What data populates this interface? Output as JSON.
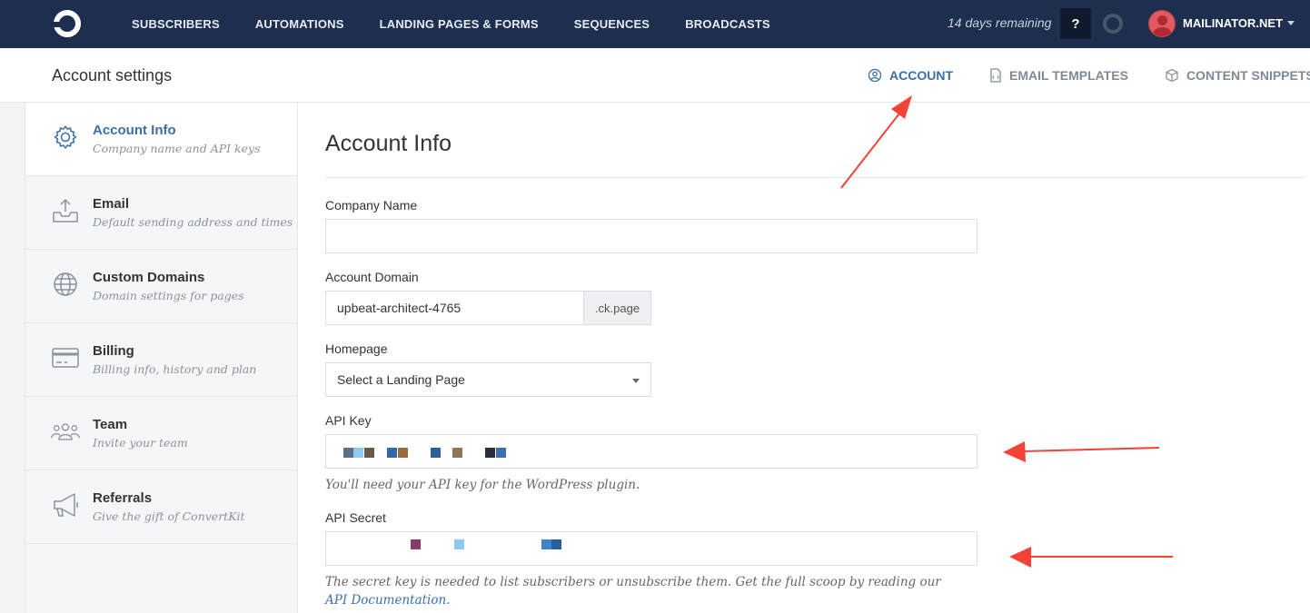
{
  "topnav": {
    "items": [
      "SUBSCRIBERS",
      "AUTOMATIONS",
      "LANDING PAGES & FORMS",
      "SEQUENCES",
      "BROADCASTS"
    ],
    "trial_text": "14 days remaining",
    "help_label": "?",
    "user_label": "MAILINATOR.NET"
  },
  "subheader": {
    "title": "Account settings",
    "tabs": [
      {
        "label": "ACCOUNT",
        "icon": "user-circle-icon",
        "active": true
      },
      {
        "label": "EMAIL TEMPLATES",
        "icon": "document-icon",
        "active": false
      },
      {
        "label": "CONTENT SNIPPETS",
        "icon": "cube-icon",
        "active": false
      }
    ]
  },
  "sidebar": {
    "items": [
      {
        "name": "Account Info",
        "desc": "Company name and API keys",
        "icon": "gear-icon",
        "active": true
      },
      {
        "name": "Email",
        "desc": "Default sending address and times",
        "icon": "inbox-upload-icon",
        "active": false
      },
      {
        "name": "Custom Domains",
        "desc": "Domain settings for pages",
        "icon": "globe-icon",
        "active": false
      },
      {
        "name": "Billing",
        "desc": "Billing info, history and plan",
        "icon": "credit-card-icon",
        "active": false
      },
      {
        "name": "Team",
        "desc": "Invite your team",
        "icon": "team-icon",
        "active": false
      },
      {
        "name": "Referrals",
        "desc": "Give the gift of ConvertKit",
        "icon": "megaphone-icon",
        "active": false
      }
    ]
  },
  "main": {
    "title": "Account Info",
    "company_label": "Company Name",
    "company_value": "",
    "domain_label": "Account Domain",
    "domain_value": "upbeat-architect-4765",
    "domain_suffix": ".ck.page",
    "homepage_label": "Homepage",
    "homepage_value": "Select a Landing Page",
    "api_key_label": "API Key",
    "api_key_hint": "You'll need your API key for the WordPress plugin.",
    "api_secret_label": "API Secret",
    "api_secret_hint": "The secret key is needed to list subscribers or unsubscribe them. Get the full scoop by reading our ",
    "api_doc_link": "API Documentation",
    "api_doc_suffix": "."
  },
  "colors": {
    "nav_bg": "#1d2e4f",
    "accent": "#3b6ea8",
    "annotation_arrow": "#f44336"
  }
}
